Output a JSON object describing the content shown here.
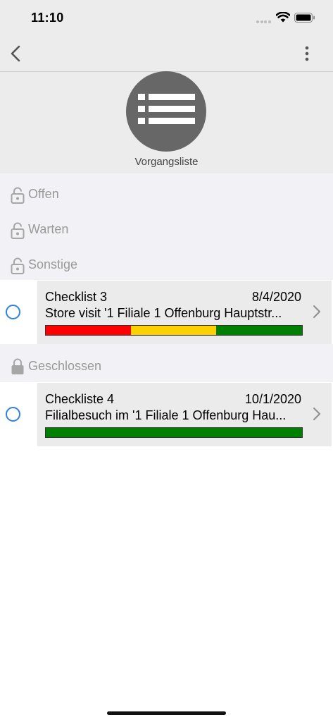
{
  "status_bar": {
    "time": "11:10"
  },
  "header": {
    "title": "Vorgangsliste"
  },
  "groups": [
    {
      "label": "Offen",
      "icon": "lock-open-icon"
    },
    {
      "label": "Warten",
      "icon": "lock-open-icon"
    },
    {
      "label": "Sonstige",
      "icon": "lock-open-icon"
    }
  ],
  "items": [
    {
      "title": "Checklist 3",
      "date": "8/4/2020",
      "subtitle": "Store visit '1 Filiale 1 Offenburg Hauptstr...",
      "progress": [
        {
          "color": "#ff0000",
          "fraction": 0.333
        },
        {
          "color": "#ffd000",
          "fraction": 0.333
        },
        {
          "color": "#008000",
          "fraction": 0.334
        }
      ]
    },
    {
      "title": "Checkliste 4",
      "date": "10/1/2020",
      "subtitle": "Filialbesuch im '1 Filiale 1 Offenburg Hau...",
      "progress": [
        {
          "color": "#008000",
          "fraction": 1.0
        }
      ]
    }
  ],
  "closed_group": {
    "label": "Geschlossen",
    "icon": "lock-closed-icon"
  },
  "colors": {
    "accent": "#2f80e6",
    "header_background": "#ececec",
    "group_background": "#f2f2f6",
    "card_background": "#ebebeb"
  }
}
